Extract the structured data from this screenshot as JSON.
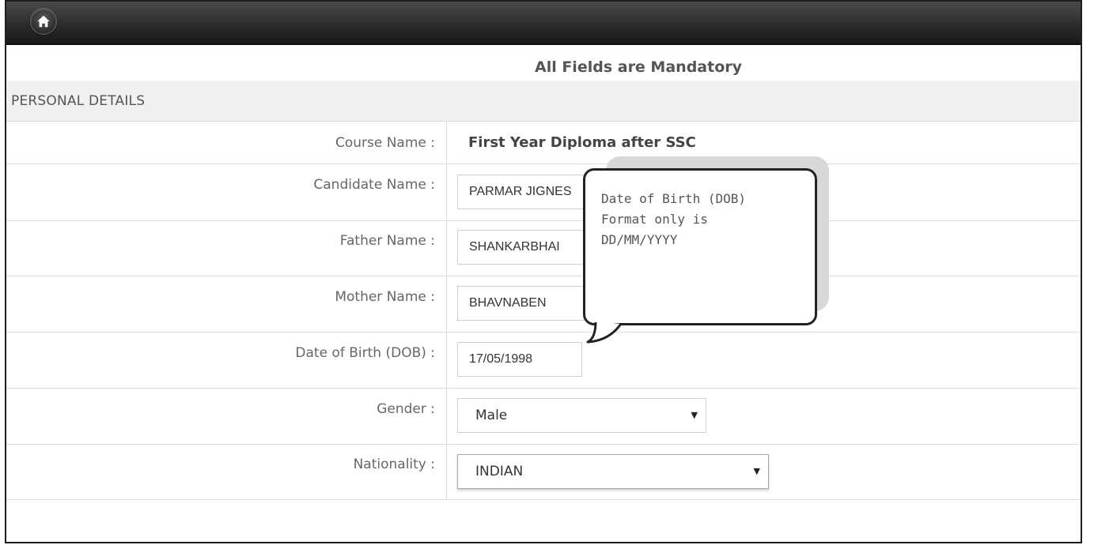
{
  "topbar": {
    "home_icon": "home-icon"
  },
  "form": {
    "notice": "All Fields are Mandatory",
    "section_title": "PERSONAL DETAILS",
    "course": {
      "label": "Course Name :",
      "value": "First Year Diploma after SSC"
    },
    "candidate_name": {
      "label": "Candidate Name :",
      "value": "PARMAR JIGNES"
    },
    "father_name": {
      "label": "Father Name :",
      "value": "SHANKARBHAI"
    },
    "mother_name": {
      "label": "Mother Name :",
      "value": "BHAVNABEN"
    },
    "dob": {
      "label": "Date of Birth (DOB) :",
      "value": "17/05/1998"
    },
    "gender": {
      "label": "Gender :",
      "selected": "Male"
    },
    "nationality": {
      "label": "Nationality :",
      "selected": "INDIAN"
    }
  },
  "tooltip": {
    "line1": "Date of Birth (DOB)",
    "line2": "Format only is",
    "line3": "DD/MM/YYYY"
  },
  "colors": {
    "topbar": "#2a2a2a",
    "section_bg": "#f0f0f0",
    "border": "#dcdcdc"
  }
}
